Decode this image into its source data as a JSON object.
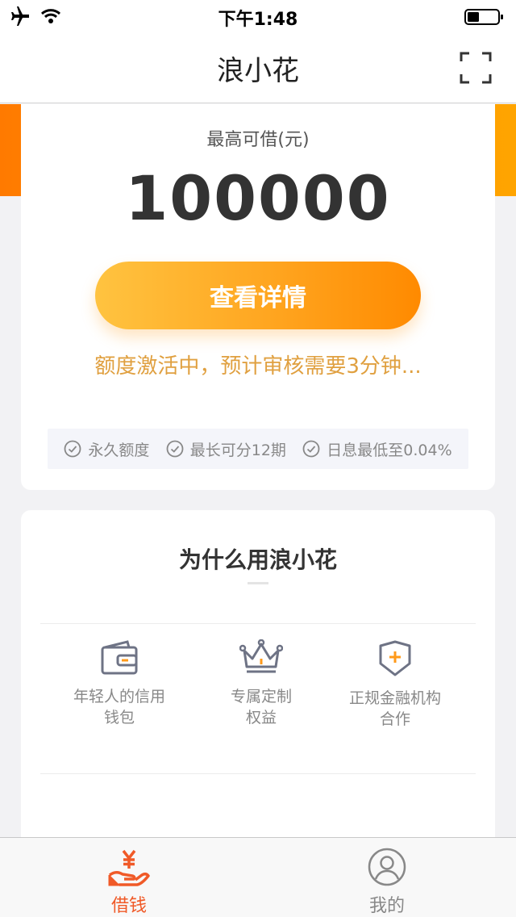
{
  "status_bar": {
    "time": "下午1:48",
    "icons": [
      "airplane-icon",
      "wifi-icon",
      "battery-icon"
    ]
  },
  "nav": {
    "title": "浪小花",
    "right_icon": "scan-icon"
  },
  "loan_card": {
    "label": "最高可借(元)",
    "amount": "100000",
    "button_label": "查看详情",
    "status_note": "额度激活中，预计审核需要3分钟...",
    "features": [
      {
        "icon": "check-circle-icon",
        "label": "永久额度"
      },
      {
        "icon": "check-circle-icon",
        "label": "最长可分12期"
      },
      {
        "icon": "check-circle-icon",
        "label": "日息最低至0.04%"
      }
    ]
  },
  "why_card": {
    "title": "为什么用浪小花",
    "benefits": [
      {
        "icon": "wallet-icon",
        "label": "年轻人的信用\n钱包"
      },
      {
        "icon": "crown-icon",
        "label": "专属定制\n权益"
      },
      {
        "icon": "shield-plus-icon",
        "label": "正规金融机构\n合作"
      }
    ]
  },
  "tab_bar": {
    "tabs": [
      {
        "icon": "hand-yen-icon",
        "label": "借钱",
        "active": true
      },
      {
        "icon": "user-icon",
        "label": "我的",
        "active": false
      }
    ]
  },
  "colors": {
    "accent_orange": "#ff9a1a",
    "active_tab": "#f05a28",
    "note_text": "#e0a040"
  }
}
